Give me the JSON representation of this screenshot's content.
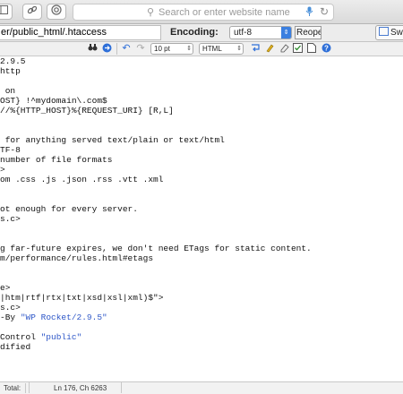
{
  "browser": {
    "address_placeholder": "Search or enter website name",
    "icons": [
      "sidebar-icon",
      "link-icon",
      "history-icon",
      "magnifier-icon",
      "microphone-icon",
      "reload-icon"
    ]
  },
  "file_bar": {
    "path": "er/public_html/.htaccess",
    "encoding_label": "Encoding:",
    "encoding_value": "utf-8",
    "reopen_label": "Reopen",
    "switch_label": "Swit"
  },
  "editor_toolbar": {
    "font_size": "10 pt",
    "syntax": "HTML"
  },
  "editor": {
    "lines": [
      {
        "text": "2.9.5"
      },
      {
        "text": "http"
      },
      {
        "text": ""
      },
      {
        "text": " on"
      },
      {
        "text": "OST} !^mydomain\\.com$"
      },
      {
        "text": "//%{HTTP_HOST}%{REQUEST_URI} [R,L]"
      },
      {
        "text": ""
      },
      {
        "text": ""
      },
      {
        "text": " for anything served text/plain or text/html"
      },
      {
        "text": "TF-8"
      },
      {
        "text": "number of file formats"
      },
      {
        "text": ">"
      },
      {
        "text": "om .css .js .json .rss .vtt .xml"
      },
      {
        "text": ""
      },
      {
        "text": ""
      },
      {
        "text": "ot enough for every server."
      },
      {
        "text": "s.c>"
      },
      {
        "text": ""
      },
      {
        "text": ""
      },
      {
        "text": "g far-future expires, we don't need ETags for static content."
      },
      {
        "text": "m/performance/rules.html#etags"
      },
      {
        "text": ""
      },
      {
        "text": ""
      },
      {
        "text": "e>"
      },
      {
        "text": "|htm|rtf|rtx|txt|xsd|xsl|xml)$\">"
      },
      {
        "text": "s.c>"
      },
      {
        "text": "-By ",
        "str": "\"WP Rocket/2.9.5\""
      },
      {
        "text": ""
      },
      {
        "text": "Control ",
        "str": "\"public\""
      },
      {
        "text": "dified"
      }
    ]
  },
  "status": {
    "total_label": "Total:",
    "position": "Ln 176, Ch 6263"
  },
  "colors": {
    "string": "#2e57c8",
    "accent_blue": "#3b7fe0"
  }
}
